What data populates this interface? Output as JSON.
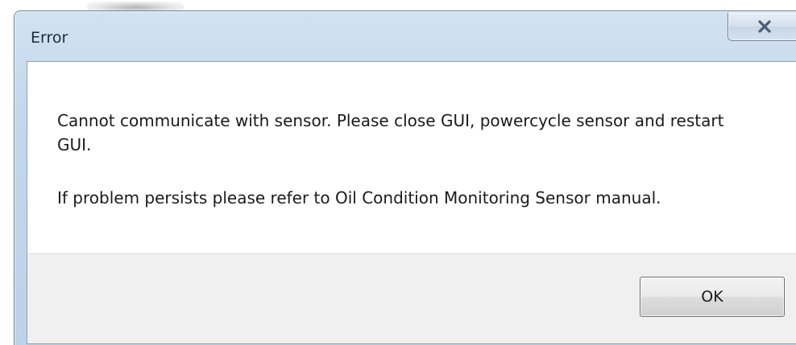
{
  "dialog": {
    "title": "Error",
    "close_icon": "close-icon",
    "message_line1": "Cannot communicate with sensor. Please close GUI, powercycle sensor and restart GUI.",
    "message_line2": "If problem persists please refer to Oil Condition Monitoring Sensor manual.",
    "ok_label": "OK"
  },
  "colors": {
    "title_bar": "#c4d7ec",
    "footer": "#f0f0f0",
    "close_glyph": "#4a5d73"
  }
}
